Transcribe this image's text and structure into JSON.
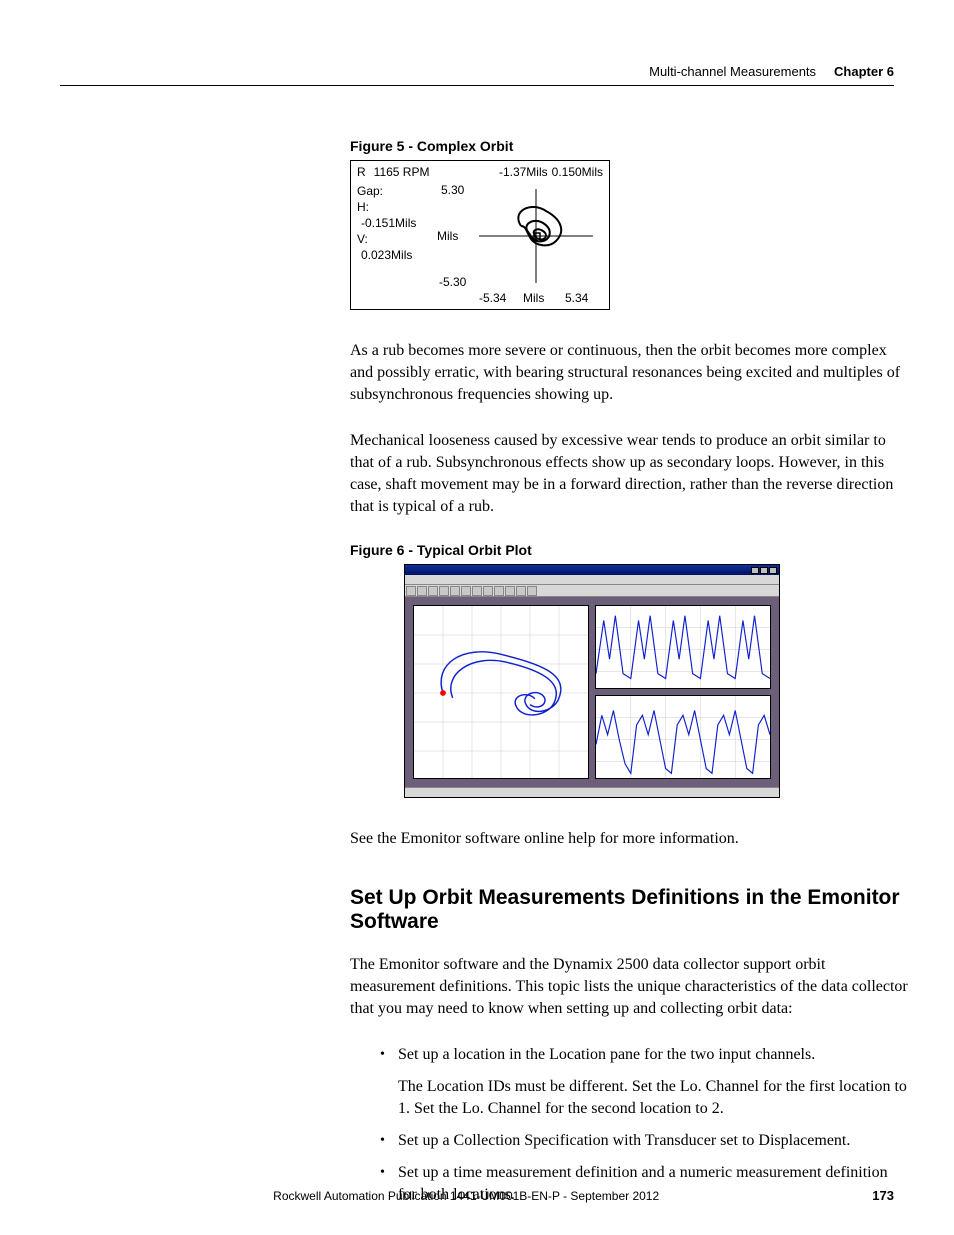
{
  "header": {
    "section": "Multi-channel Measurements",
    "chapter": "Chapter 6"
  },
  "figure5": {
    "caption": "Figure 5 - Complex Orbit",
    "indicator": "R",
    "rpm": "1165 RPM",
    "top_val1": "-1.37Mils",
    "top_val2": "0.150Mils",
    "gap_label": "Gap:",
    "h_label": "H:",
    "h_val": "-0.151Mils",
    "v_label": "V:",
    "v_val": "0.023Mils",
    "y_top": "5.30",
    "y_bot": "-5.30",
    "y_unit_mid": "Mils",
    "x_left": "-5.34",
    "x_unit": "Mils",
    "x_right": "5.34"
  },
  "para1": "As a rub becomes more severe or continuous, then the orbit becomes more complex and possibly erratic, with bearing structural resonances being excited and multiples of subsynchronous frequencies showing up.",
  "para2": "Mechanical looseness caused by excessive wear tends to produce an orbit similar to that of a rub. Subsynchronous effects show up as secondary loops. However, in this case, shaft movement may be in a forward direction, rather than the reverse direction that is typical of a rub.",
  "figure6": {
    "caption": "Figure 6 - Typical Orbit Plot"
  },
  "para3": "See the Emonitor software online help for more information.",
  "h2": "Set Up Orbit Measurements Definitions in the Emonitor Software",
  "para4": "The Emonitor software and the Dynamix 2500 data collector support orbit measurement definitions. This topic lists the unique characteristics of the data collector that you may need to know when setting up and collecting orbit data:",
  "bullets": {
    "b1": "Set up a location in the Location pane for the two input channels.",
    "b1_sub": "The Location IDs must be different. Set the Lo. Channel for the first location to 1. Set the Lo. Channel for the second location to 2.",
    "b2": "Set up a Collection Specification with Transducer set to Displacement.",
    "b3": "Set up a time measurement definition and a numeric measurement definition for both locations."
  },
  "footer": {
    "pub": "Rockwell Automation Publication 1441-UM001B-EN-P - September 2012",
    "page": "173"
  }
}
